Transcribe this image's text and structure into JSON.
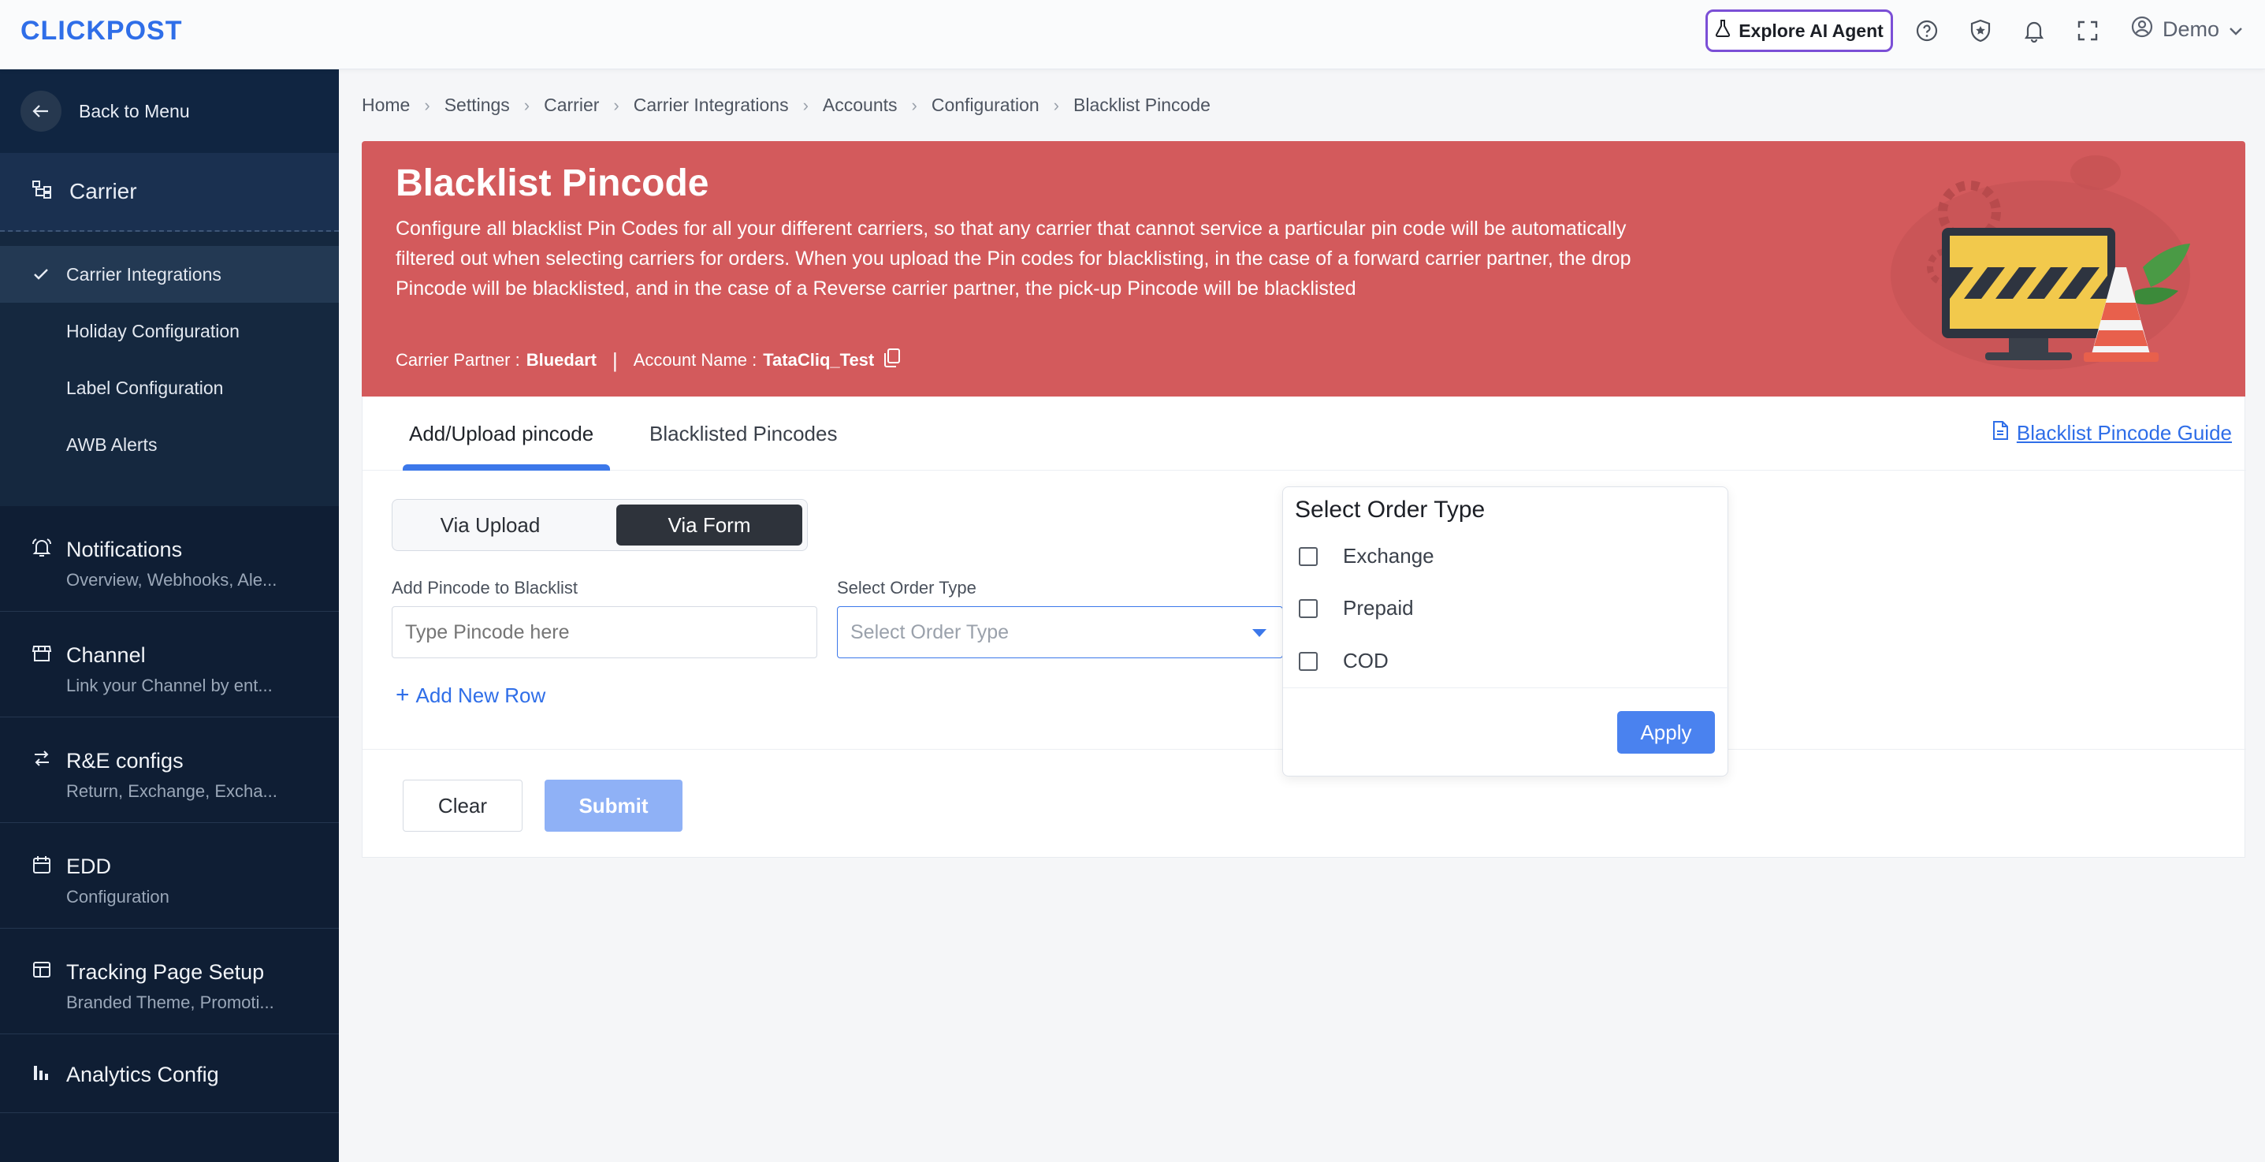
{
  "header": {
    "logo_bold": "CLICK",
    "logo_rest": "POST",
    "ai_agent_label": "Explore AI Agent",
    "user_label": "Demo"
  },
  "sidebar": {
    "back_label": "Back to Menu",
    "section_title": "Carrier",
    "sub_items": [
      {
        "label": "Carrier Integrations",
        "active": true
      },
      {
        "label": "Holiday Configuration"
      },
      {
        "label": "Label Configuration"
      },
      {
        "label": "AWB Alerts"
      }
    ],
    "nav": [
      {
        "title": "Notifications",
        "subtitle": "Overview, Webhooks, Ale..."
      },
      {
        "title": "Channel",
        "subtitle": "Link your Channel by ent..."
      },
      {
        "title": "R&E configs",
        "subtitle": "Return, Exchange, Excha..."
      },
      {
        "title": "EDD",
        "subtitle": "Configuration"
      },
      {
        "title": "Tracking Page Setup",
        "subtitle": "Branded Theme, Promoti..."
      },
      {
        "title": "Analytics Config",
        "subtitle": ""
      }
    ]
  },
  "breadcrumb": [
    "Home",
    "Settings",
    "Carrier",
    "Carrier Integrations",
    "Accounts",
    "Configuration",
    "Blacklist Pincode"
  ],
  "banner": {
    "title": "Blacklist Pincode",
    "description": "Configure all blacklist Pin Codes for all your different carriers, so that any carrier that cannot service a particular pin code will be automatically filtered out when selecting carriers for orders. When you upload the Pin codes for blacklisting, in the case of a forward carrier partner, the drop Pincode will be blacklisted, and in the case of a Reverse carrier partner, the pick-up Pincode will be blacklisted",
    "carrier_partner_label": "Carrier Partner :",
    "carrier_partner_value": "Bluedart",
    "account_name_label": "Account Name :",
    "account_name_value": "TataCliq_Test"
  },
  "tabs": {
    "add_upload": "Add/Upload pincode",
    "blacklisted": "Blacklisted Pincodes",
    "guide_link": "Blacklist Pincode Guide"
  },
  "form": {
    "mode_upload": "Via Upload",
    "mode_form": "Via Form",
    "pincode_label": "Add Pincode to Blacklist",
    "pincode_placeholder": "Type Pincode here",
    "order_type_label": "Select Order Type",
    "order_type_placeholder": "Select Order Type",
    "add_row": "Add New Row",
    "clear": "Clear",
    "submit": "Submit"
  },
  "order_type_popover": {
    "title": "Select Order Type",
    "options": [
      "Exchange",
      "Prepaid",
      "COD"
    ],
    "apply": "Apply"
  },
  "colors": {
    "brand": "#2f6ee8",
    "banner": "#d35a5c",
    "sidebar": "#0f1e34",
    "ai_border": "#7b4fd6"
  }
}
